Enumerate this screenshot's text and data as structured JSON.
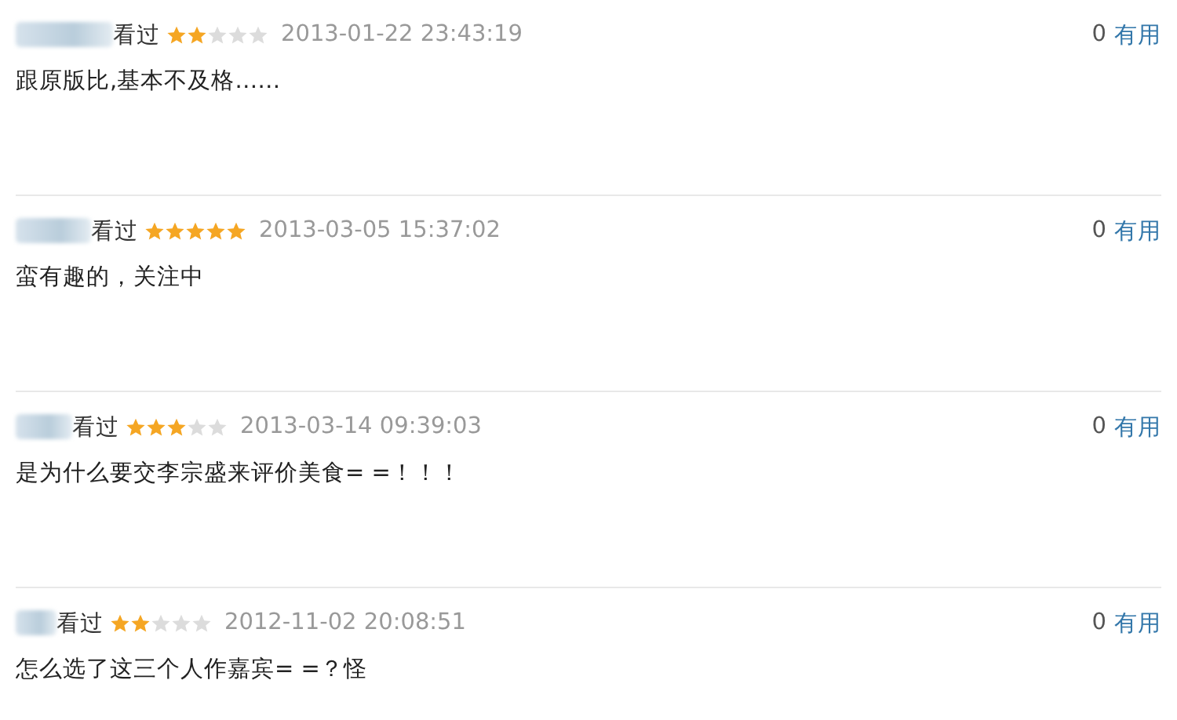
{
  "comments": [
    {
      "status": "看过",
      "stars": 2,
      "time": "2013-01-22 23:43:19",
      "text": "跟原版比,基本不及格……",
      "votes": "0",
      "useful": "有用"
    },
    {
      "status": "看过",
      "stars": 5,
      "time": "2013-03-05 15:37:02",
      "text": "蛮有趣的，关注中",
      "votes": "0",
      "useful": "有用"
    },
    {
      "status": "看过",
      "stars": 3,
      "time": "2013-03-14 09:39:03",
      "text": "是为什么要交李宗盛来评价美食= =！！！",
      "votes": "0",
      "useful": "有用"
    },
    {
      "status": "看过",
      "stars": 2,
      "time": "2012-11-02 20:08:51",
      "text": "怎么选了这三个人作嘉宾= =？怪",
      "votes": "0",
      "useful": "有用"
    }
  ]
}
